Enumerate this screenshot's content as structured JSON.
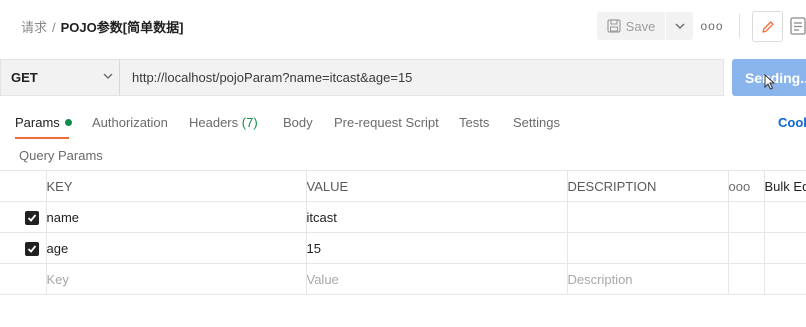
{
  "header": {
    "breadcrumb_parent": "请求",
    "breadcrumb_separator": "/",
    "request_name": "POJO参数[简单数据]",
    "save_label": "Save",
    "more_label": "ooo"
  },
  "request": {
    "method": "GET",
    "url": "http://localhost/pojoParam?name=itcast&age=15",
    "send_label": "Sending..."
  },
  "tabs": {
    "params": "Params",
    "authorization": "Authorization",
    "headers": "Headers",
    "headers_count": "(7)",
    "body": "Body",
    "pre_request": "Pre-request Script",
    "tests": "Tests",
    "settings": "Settings",
    "cookies": "Cookies"
  },
  "section_title": "Query Params",
  "table": {
    "headers": {
      "key": "KEY",
      "value": "VALUE",
      "description": "DESCRIPTION",
      "more": "ooo",
      "bulk": "Bulk Edit"
    },
    "rows": [
      {
        "checked": true,
        "key": "name",
        "value": "itcast",
        "description": ""
      },
      {
        "checked": true,
        "key": "age",
        "value": "15",
        "description": ""
      }
    ],
    "placeholders": {
      "key": "Key",
      "value": "Value",
      "description": "Description"
    }
  },
  "colors": {
    "accent_tab": "#f26b3a",
    "param_dot": "#0f8c4e",
    "send_button": "#8ab4ec",
    "link": "#0b66d8"
  }
}
